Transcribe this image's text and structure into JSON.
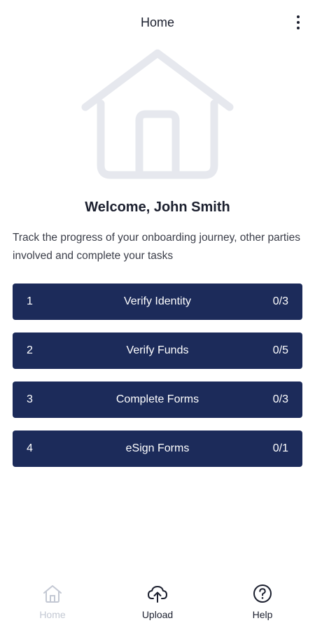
{
  "header": {
    "title": "Home",
    "menu_icon": "more-vertical-icon"
  },
  "hero": {
    "icon": "house-icon",
    "color": "#e6e8ee"
  },
  "welcome": {
    "title": "Welcome, John Smith",
    "description": "Track the progress of your onboarding journey, other parties involved and complete your tasks"
  },
  "steps": [
    {
      "number": "1",
      "label": "Verify Identity",
      "progress": "0/3"
    },
    {
      "number": "2",
      "label": "Verify Funds",
      "progress": "0/5"
    },
    {
      "number": "3",
      "label": "Complete Forms",
      "progress": "0/3"
    },
    {
      "number": "4",
      "label": "eSign Forms",
      "progress": "0/1"
    }
  ],
  "bottom_nav": {
    "items": [
      {
        "label": "Home",
        "icon": "home-icon",
        "active": false
      },
      {
        "label": "Upload",
        "icon": "cloud-upload-icon",
        "active": true
      },
      {
        "label": "Help",
        "icon": "help-circle-icon",
        "active": true
      }
    ]
  },
  "colors": {
    "primary": "#1c2b5a",
    "text": "#1b1f2e",
    "muted": "#c3c8d3"
  }
}
